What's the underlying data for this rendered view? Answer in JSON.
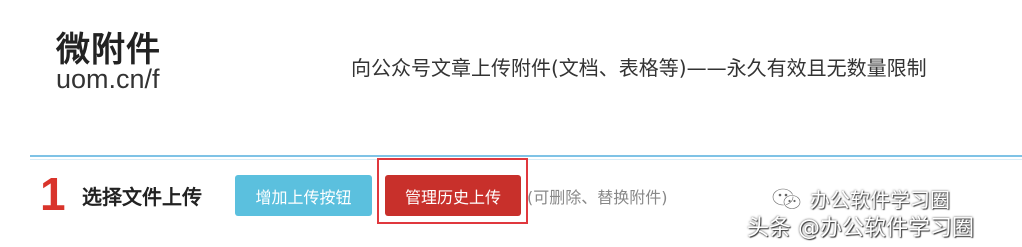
{
  "brand": {
    "title": "微附件",
    "url": "uom.cn/f"
  },
  "tagline": "向公众号文章上传附件(文档、表格等)——永久有效且无数量限制",
  "step": {
    "number": "1",
    "label": "选择文件上传",
    "add_button": "增加上传按钮",
    "manage_button": "管理历史上传",
    "hint": "(可删除、替换附件)"
  },
  "watermark": {
    "account": "办公软件学习圈",
    "source": "头条 @办公软件学习圈",
    "icon": "wechat-icon"
  },
  "colors": {
    "add_button": "#5bc0de",
    "manage_button": "#c8302b",
    "step_number": "#d9342b",
    "divider": "#7fc3e6",
    "highlight_box": "#e0383e"
  }
}
